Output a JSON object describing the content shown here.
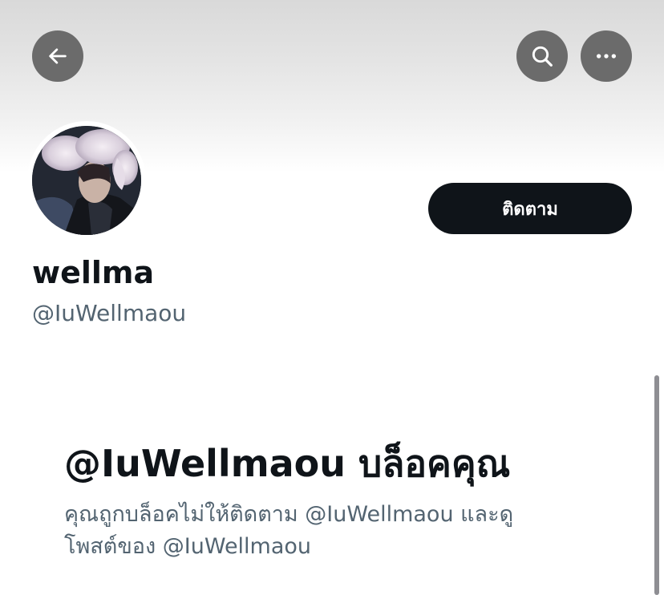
{
  "header": {
    "back_icon": "arrow-left-icon",
    "search_icon": "search-icon",
    "more_icon": "more-horizontal-icon"
  },
  "profile": {
    "display_name": "wellma",
    "handle": "@IuWellmaou",
    "follow_label": "ติดตาม"
  },
  "blocked_notice": {
    "title": "@IuWellmaou บล็อคคุณ",
    "line1": "คุณถูกบล็อคไม่ให้ติดตาม @IuWellmaou และดู",
    "line2": "โพสต์ของ @IuWellmaou"
  },
  "colors": {
    "button_dark": "#0f1419",
    "secondary_text": "#536471",
    "overlay_button": "#6b6b6b"
  }
}
